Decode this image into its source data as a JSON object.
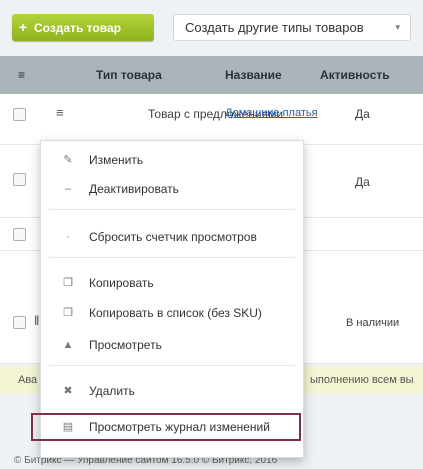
{
  "toolbar": {
    "add_button_label": "Создать товар",
    "types_button_label": "Создать другие типы товаров",
    "types_chevron": "▾"
  },
  "grid": {
    "columns": [
      "Тип товара",
      "Название",
      "Активность"
    ],
    "rows": [
      {
        "type": "Товар с предложениями",
        "name": "Домашние платья",
        "active": "Да"
      },
      {
        "active": "Да"
      },
      {
        "status": "В наличии"
      }
    ]
  },
  "notice": {
    "text_left": "Ава",
    "text_right": "ыполнению всем вы"
  },
  "footer": {
    "text": "© Битрикс — Управление сайтом 16.5.0 © Битрикс, 2016"
  },
  "context_menu": {
    "items": [
      {
        "label": "Изменить",
        "icon": "edit-icon",
        "glyph": "✎"
      },
      {
        "label": "Деактивировать",
        "icon": "minus-icon",
        "glyph": "–"
      },
      {
        "label": "Сбросить счетчик просмотров",
        "icon": "reset-icon",
        "glyph": "·"
      },
      {
        "label": "Копировать",
        "icon": "copy-icon",
        "glyph": "❐"
      },
      {
        "label": "Копировать в список (без SKU)",
        "icon": "copy-list-icon",
        "glyph": "❐"
      },
      {
        "label": "Просмотреть",
        "icon": "view-icon",
        "glyph": "▲"
      },
      {
        "label": "Удалить",
        "icon": "delete-icon",
        "glyph": "✖"
      },
      {
        "label": "Просмотреть журнал изменений",
        "icon": "history-icon",
        "glyph": "▤"
      }
    ]
  }
}
